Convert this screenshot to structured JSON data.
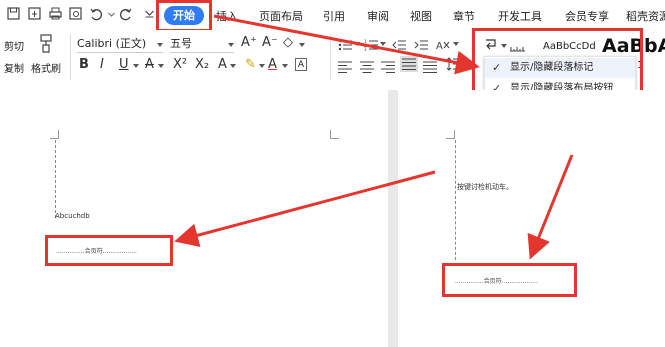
{
  "menu": {
    "active_tab": "开始",
    "tabs": [
      "插入",
      "页面布局",
      "引用",
      "审阅",
      "视图",
      "章节",
      "开发工具",
      "会员专享",
      "稻壳资源"
    ]
  },
  "ribbon": {
    "cut_label": "剪切",
    "copy_label": "复制",
    "format_painter_label": "格式刷",
    "font_name": "Calibri (正文)",
    "font_size": "五号",
    "style_preview_1": "AaBbCcDd",
    "style_preview_2": "AaBbA",
    "spacing_value": "1"
  },
  "dropdown": {
    "items": [
      "显示/隐藏段落标记",
      "显示/隐藏段落布局按钮"
    ]
  },
  "document": {
    "page1_text": "Abcuchdb",
    "page1_field": "...............合页符..................",
    "page2_text": "按键讨检机动车。",
    "page2_field": "...............合页符..................."
  },
  "colors": {
    "accent": "#2f7cf6",
    "annotation_red": "#e5352f"
  }
}
